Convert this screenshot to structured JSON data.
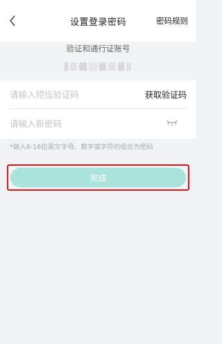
{
  "nav": {
    "title": "设置登录密码",
    "right_label": "密码规则",
    "back_icon": "chevron-left-icon"
  },
  "account": {
    "label": "验证和通行证账号"
  },
  "form": {
    "code_placeholder": "请输入短信验证码",
    "code_value": "",
    "get_code_label": "获取验证码",
    "password_placeholder": "请输入新密码",
    "password_value": "",
    "eye_icon": "eye-closed-icon"
  },
  "hint": "*输入8-16位英文字母、数字或字符的组合为密码",
  "submit_label": "完成",
  "colors": {
    "button": "#a9e3db",
    "highlight": "#e4141b",
    "background": "#f2f3f5"
  }
}
